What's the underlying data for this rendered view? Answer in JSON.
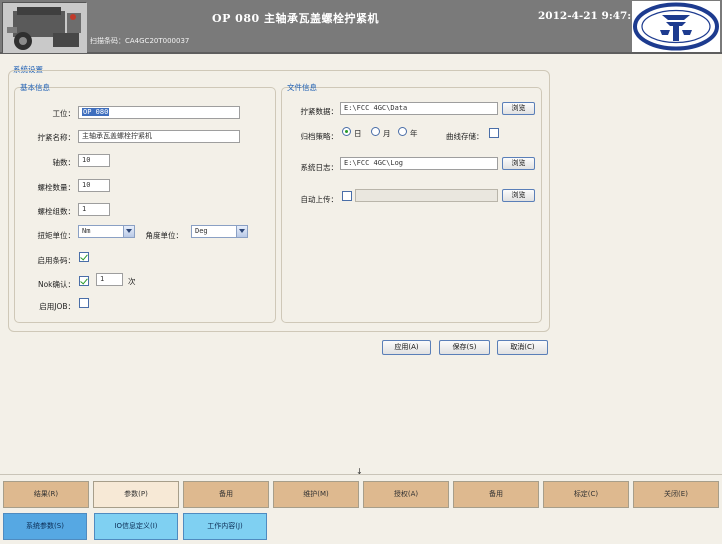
{
  "header": {
    "station_title": "OP 080   主轴承瓦盖螺栓拧紧机",
    "datetime": "2012-4-21  9:47:",
    "barcode_label": "扫描条码：",
    "barcode_value": "CA4GC20T000037"
  },
  "settings": {
    "title": "系统设置",
    "basic": {
      "title": "基本信息",
      "station_label": "工位：",
      "station_value": "OP 080",
      "name_label": "拧紧名称：",
      "name_value": "主轴承瓦盖螺栓拧紧机",
      "axes_label": "轴数：",
      "axes_value": "10",
      "bolt_count_label": "螺栓数量：",
      "bolt_count_value": "10",
      "bolt_groups_label": "螺栓组数：",
      "bolt_groups_value": "1",
      "torque_unit_label": "扭矩单位：",
      "torque_unit_value": "Nm",
      "angle_unit_label": "角度单位：",
      "angle_unit_value": "Deg",
      "barcode_enable_label": "启用条码：",
      "barcode_enable_checked": true,
      "nok_confirm_label": "Nok确认：",
      "nok_confirm_checked": true,
      "nok_times_value": "1",
      "nok_times_unit": "次",
      "job_enable_label": "启用JOB：",
      "job_enable_checked": false
    },
    "file": {
      "title": "文件信息",
      "data_label": "拧紧数据：",
      "data_path": "E:\\FCC 4GC\\Data",
      "browse_label": "浏览",
      "policy_label": "归档策略：",
      "policy_options": [
        "日",
        "月",
        "年"
      ],
      "policy_selected": "日",
      "curve_label": "曲线存储：",
      "curve_checked": false,
      "log_label": "系统日志：",
      "log_path": "E:\\FCC 4GC\\Log",
      "upload_label": "自动上传：",
      "upload_checked": false,
      "upload_path": ""
    },
    "buttons": {
      "apply": "应用(A)",
      "save": "保存(S)",
      "cancel": "取消(C)"
    }
  },
  "nav": {
    "main": [
      "结果(R)",
      "参数(P)",
      "备用",
      "维护(M)",
      "授权(A)",
      "备用",
      "标定(C)",
      "关闭(E)"
    ],
    "active_main": "参数(P)",
    "sub": [
      "系统参数(S)",
      "IO信息定义(I)",
      "工作内容(J)"
    ],
    "active_sub": "系统参数(S)"
  },
  "colors": {
    "header_bg": "#7a7a7a",
    "title_blue": "#1e5fb4",
    "nav_tan": "#deb98f",
    "sub_blue": "#7fd0f2"
  },
  "icons": {
    "engine": "engine-photo-icon",
    "logo": "faw-logo-icon",
    "arrow": "down-arrow-icon"
  }
}
